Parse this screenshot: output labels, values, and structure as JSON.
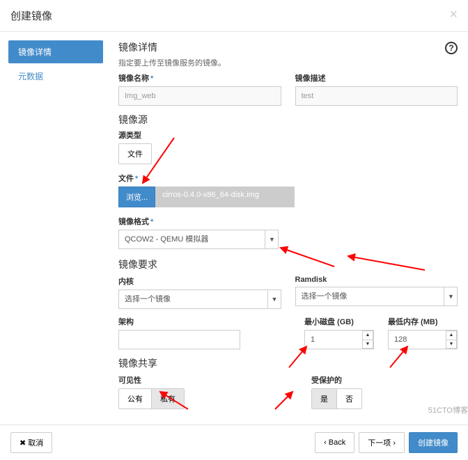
{
  "modal_title": "创建镜像",
  "sidebar": {
    "items": [
      {
        "label": "镜像详情",
        "active": true
      },
      {
        "label": "元数据",
        "active": false
      }
    ]
  },
  "details": {
    "title": "镜像详情",
    "subtitle": "指定要上传至镜像服务的镜像。",
    "name_label": "镜像名称",
    "name_value": "Img_web",
    "desc_label": "镜像描述",
    "desc_value": "test"
  },
  "source": {
    "title": "镜像源",
    "type_label": "源类型",
    "type_button": "文件",
    "file_label": "文件",
    "browse_label": "浏览...",
    "file_name": "cirros-0.4.0-x86_64-disk.img"
  },
  "format": {
    "label": "镜像格式",
    "value": "QCOW2 - QEMU 模拟器"
  },
  "requirements": {
    "title": "镜像要求",
    "kernel_label": "内核",
    "kernel_value": "选择一个镜像",
    "ramdisk_label": "Ramdisk",
    "ramdisk_value": "选择一个镜像",
    "arch_label": "架构",
    "arch_value": "",
    "min_disk_label": "最小磁盘 (GB)",
    "min_disk_value": "1",
    "min_ram_label": "最低内存 (MB)",
    "min_ram_value": "128"
  },
  "sharing": {
    "title": "镜像共享",
    "visibility_label": "可见性",
    "visibility_public": "公有",
    "visibility_private": "私有",
    "protected_label": "受保护的",
    "protected_yes": "是",
    "protected_no": "否"
  },
  "footer": {
    "cancel": "取消",
    "back": "Back",
    "next": "下一项",
    "create": "创建镜像"
  },
  "watermark": "51CTO博客"
}
